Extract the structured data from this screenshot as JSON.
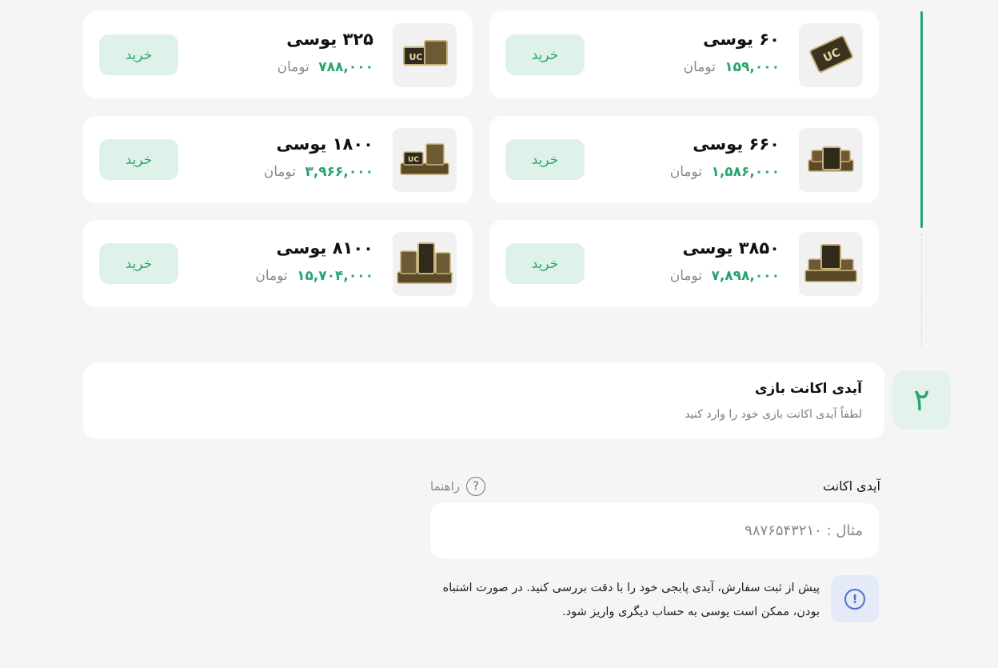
{
  "products": [
    {
      "title": "۶۰ یوسی",
      "price": "۱۵۹,۰۰۰",
      "unit": "تومان",
      "buy_label": "خرید"
    },
    {
      "title": "۳۲۵ یوسی",
      "price": "۷۸۸,۰۰۰",
      "unit": "تومان",
      "buy_label": "خرید"
    },
    {
      "title": "۶۶۰ یوسی",
      "price": "۱,۵۸۶,۰۰۰",
      "unit": "تومان",
      "buy_label": "خرید"
    },
    {
      "title": "۱۸۰۰ یوسی",
      "price": "۳,۹۶۶,۰۰۰",
      "unit": "تومان",
      "buy_label": "خرید"
    },
    {
      "title": "۳۸۵۰ یوسی",
      "price": "۷,۸۹۸,۰۰۰",
      "unit": "تومان",
      "buy_label": "خرید"
    },
    {
      "title": "۸۱۰۰ یوسی",
      "price": "۱۵,۷۰۴,۰۰۰",
      "unit": "تومان",
      "buy_label": "خرید"
    }
  ],
  "step2": {
    "number": "۲",
    "title": "آیدی اکانت بازی",
    "subtitle": "لطفاً آیدی اکانت بازی خود را وارد کنید"
  },
  "account_field": {
    "label": "آیدی اکانت",
    "help_label": "راهنما",
    "placeholder": "مثال : ۹۸۷۶۵۴۳۲۱۰",
    "value": ""
  },
  "notice": {
    "icon": "info-icon",
    "text": "پیش از ثبت سفارش، آیدی پابجی خود را با دقت بررسی کنید. در صورت اشتباه بودن، ممکن است یوسی به حساب دیگری واریز شود."
  },
  "colors": {
    "accent": "#27a56f",
    "accent_soft": "#dff2ea",
    "info": "#4d72c9"
  }
}
